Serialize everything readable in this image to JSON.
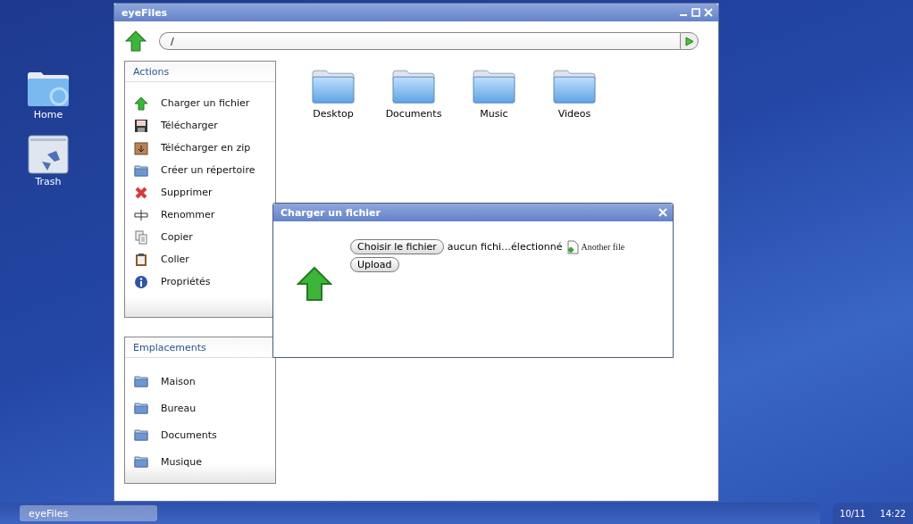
{
  "desktop_icons": [
    {
      "label": "Home",
      "kind": "folder"
    },
    {
      "label": "Trash",
      "kind": "trash"
    }
  ],
  "window": {
    "title": "eyeFiles",
    "path": "/",
    "panels": [
      {
        "title": "Actions",
        "items": [
          {
            "label": "Charger un fichier",
            "kind": "upload"
          },
          {
            "label": "Télécharger",
            "kind": "save"
          },
          {
            "label": "Télécharger en zip",
            "kind": "zip"
          },
          {
            "label": "Créer un répertoire",
            "kind": "folder"
          },
          {
            "label": "Supprimer",
            "kind": "delete"
          },
          {
            "label": "Renommer",
            "kind": "rename"
          },
          {
            "label": "Copier",
            "kind": "copy"
          },
          {
            "label": "Coller",
            "kind": "paste"
          },
          {
            "label": "Propriétés",
            "kind": "info"
          }
        ]
      },
      {
        "title": "Emplacements",
        "items": [
          {
            "label": "Maison",
            "kind": "folder"
          },
          {
            "label": "Bureau",
            "kind": "folder"
          },
          {
            "label": "Documents",
            "kind": "folder"
          },
          {
            "label": "Musique",
            "kind": "folder"
          }
        ]
      }
    ],
    "files": [
      {
        "name": "Desktop"
      },
      {
        "name": "Documents"
      },
      {
        "name": "Music"
      },
      {
        "name": "Videos"
      }
    ]
  },
  "dialog": {
    "title": "Charger un fichier",
    "choose_button": "Choisir le fichier",
    "file_status": "aucun fichi…électionné",
    "another_file": "Another file",
    "upload_button": "Upload"
  },
  "taskbar": {
    "tasks": [
      {
        "label": "eyeFiles"
      }
    ],
    "date": "10/11",
    "time": "14:22"
  }
}
